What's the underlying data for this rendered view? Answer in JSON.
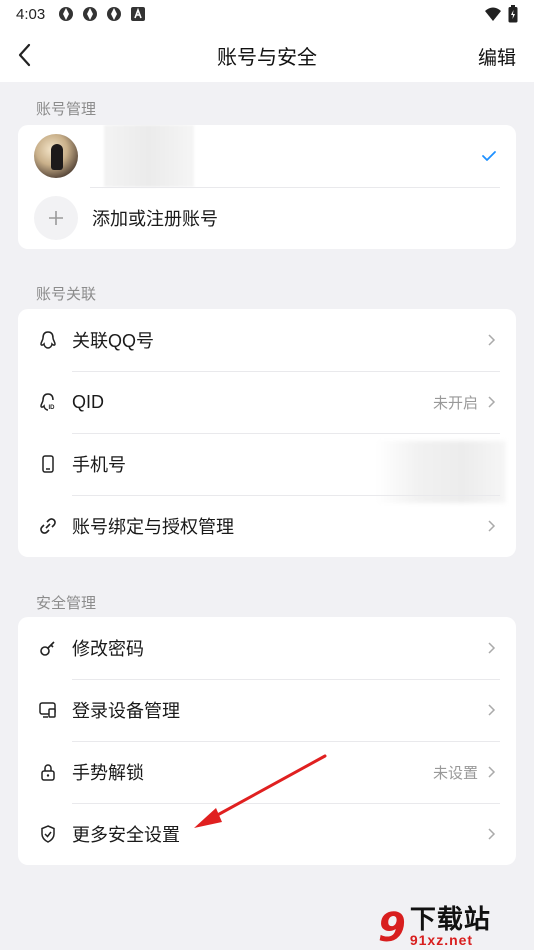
{
  "status_bar": {
    "time": "4:03"
  },
  "nav": {
    "title": "账号与安全",
    "edit": "编辑"
  },
  "sections": {
    "accounts": {
      "label": "账号管理",
      "add_label": "添加或注册账号"
    },
    "linking": {
      "label": "账号关联",
      "items": [
        {
          "label": "关联QQ号",
          "value": ""
        },
        {
          "label": "QID",
          "value": "未开启"
        },
        {
          "label": "手机号",
          "value": ""
        },
        {
          "label": "账号绑定与授权管理",
          "value": ""
        }
      ]
    },
    "security": {
      "label": "安全管理",
      "items": [
        {
          "label": "修改密码",
          "value": ""
        },
        {
          "label": "登录设备管理",
          "value": ""
        },
        {
          "label": "手势解锁",
          "value": "未设置"
        },
        {
          "label": "更多安全设置",
          "value": ""
        }
      ]
    }
  },
  "watermark": {
    "mark": "9",
    "cn": "下载站",
    "url": "91xz.net"
  },
  "colors": {
    "accent": "#1e90ff",
    "annotation_arrow": "#e02020",
    "background": "#f1f1f4"
  }
}
